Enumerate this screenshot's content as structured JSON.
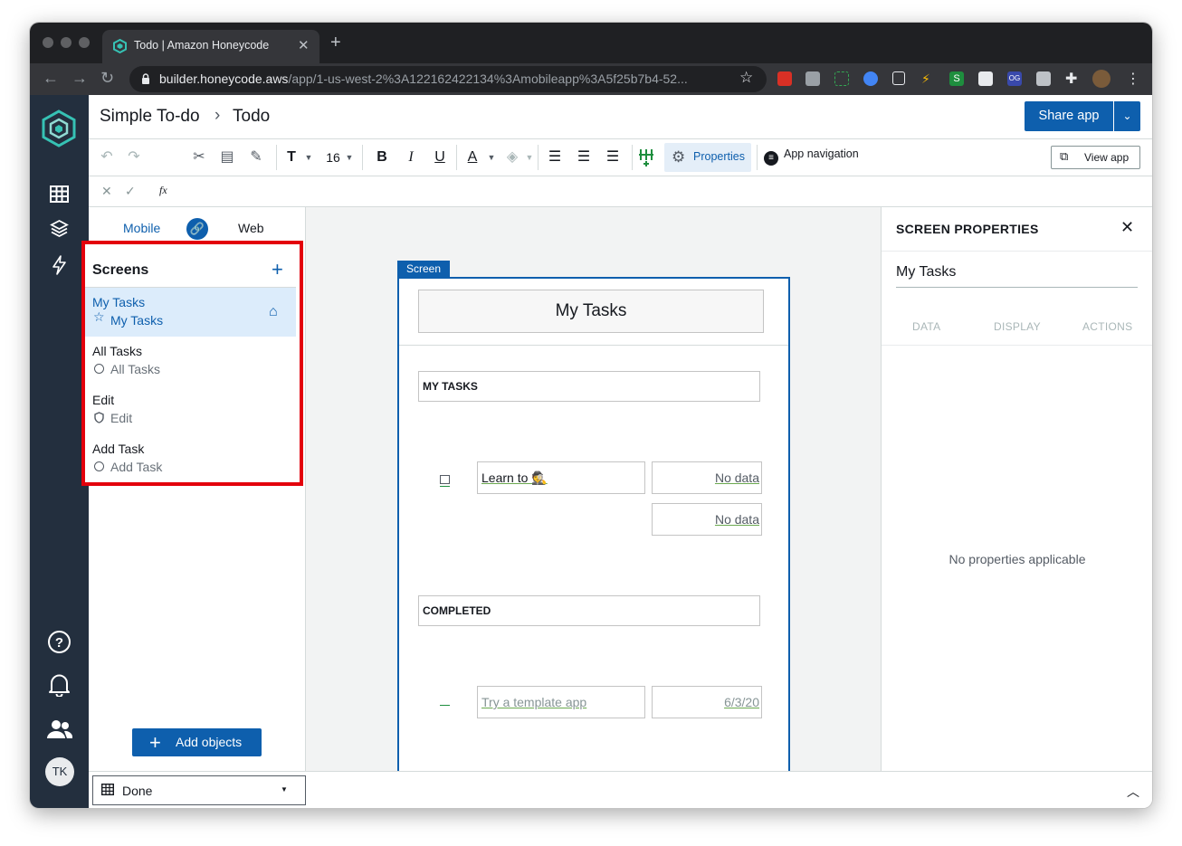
{
  "browser": {
    "tab_title": "Todo | Amazon Honeycode",
    "url_host": "builder.honeycode.aws",
    "url_path": "/app/1-us-west-2%3A122162422134%3Amobileapp%3A5f25b7b4-52..."
  },
  "header": {
    "breadcrumb_app": "Simple To-do",
    "breadcrumb_page": "Todo",
    "share_label": "Share app"
  },
  "toolbar": {
    "font_size": "16",
    "properties_label": "Properties",
    "app_navigation_label": "App navigation",
    "view_app_label": "View app",
    "formula_label": "fx"
  },
  "left_panel": {
    "tab_mobile": "Mobile",
    "tab_web": "Web",
    "screens_title": "Screens",
    "screens": [
      {
        "name": "My Tasks",
        "sub": "My Tasks",
        "icon": "star-icon",
        "active": true
      },
      {
        "name": "All Tasks",
        "sub": "All Tasks",
        "icon": "circle-icon",
        "active": false
      },
      {
        "name": "Edit",
        "sub": "Edit",
        "icon": "shield-icon",
        "active": false
      },
      {
        "name": "Add Task",
        "sub": "Add Task",
        "icon": "circle-icon",
        "active": false
      }
    ],
    "add_objects_label": "Add objects"
  },
  "canvas": {
    "screen_tag": "Screen",
    "title": "My Tasks",
    "sections": [
      {
        "label": "MY TASKS",
        "task": "Learn to 🕵",
        "values": [
          "No data",
          "No data"
        ]
      },
      {
        "label": "COMPLETED",
        "task": "Try a template app",
        "values": [
          "6/3/20"
        ]
      }
    ]
  },
  "right_panel": {
    "title": "SCREEN PROPERTIES",
    "screen_name": "My Tasks",
    "tabs": [
      "DATA",
      "DISPLAY",
      "ACTIONS"
    ],
    "empty_message": "No properties applicable"
  },
  "bottom": {
    "table_select": "Done"
  },
  "rail": {
    "avatar_initials": "TK"
  },
  "colors": {
    "accent": "#0e5fad",
    "rail": "#232f3e",
    "highlight_border": "#e3000b",
    "active_row": "#dcecfb"
  }
}
